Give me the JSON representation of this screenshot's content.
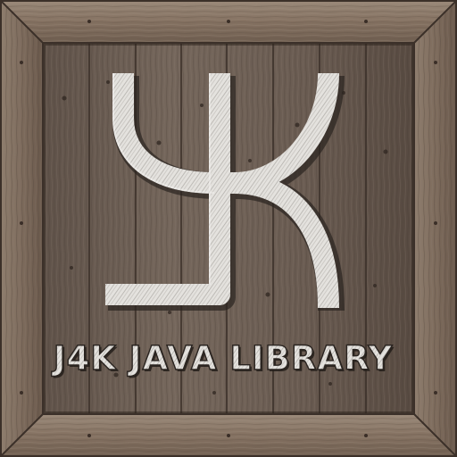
{
  "logo": {
    "caption": "J4K JAVA LIBRARY",
    "mark_description_icon": "j4k-monogram-icon"
  },
  "colors": {
    "frame_wood": "#8a7868",
    "panel_wood": "#6e6055",
    "plank_seam": "#3c312a",
    "engraved_fill": "#e4e2de",
    "engraved_hatch": "#8c8782",
    "text_fill": "#d8d4cf",
    "text_outline": "#2a2420"
  }
}
